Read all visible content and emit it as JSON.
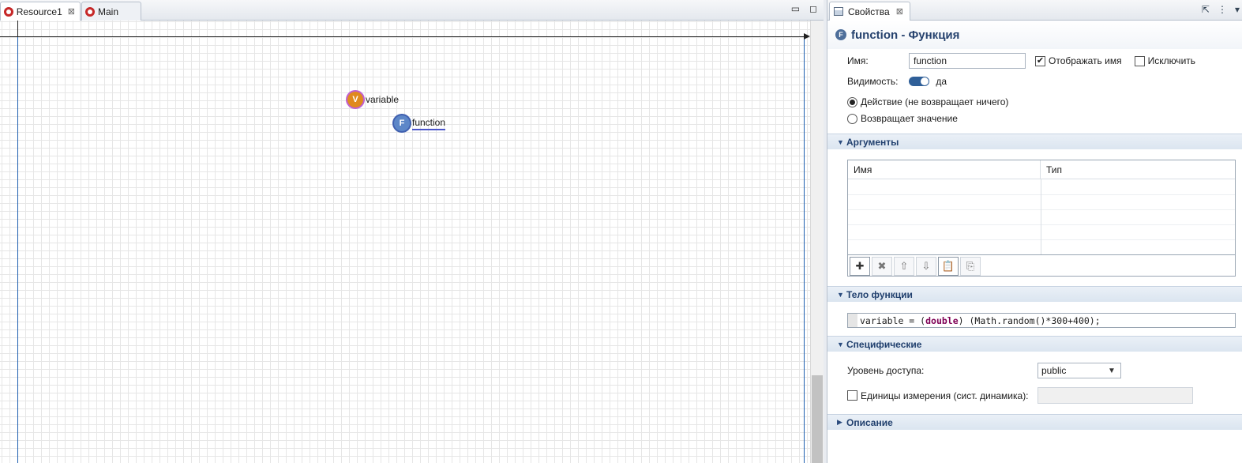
{
  "editor": {
    "tabs": [
      {
        "label": "Resource1",
        "close": "⊠",
        "icon": "resource-icon"
      },
      {
        "label": "Main",
        "icon": "resource-icon"
      }
    ],
    "window_controls": {
      "minimize": "▭",
      "maximize": "◻"
    },
    "canvas": {
      "variable_icon_letter": "V",
      "variable_label": "variable",
      "function_icon_letter": "F",
      "function_label": "function"
    }
  },
  "properties": {
    "tab_label": "Свойства",
    "tab_close": "⊠",
    "toolbar": {
      "pin": "⇱",
      "menu": "⋮",
      "more": "▾"
    },
    "title_icon_letter": "F",
    "title": "function - Функция",
    "name_label": "Имя:",
    "name_value": "function",
    "show_name_label": "Отображать имя",
    "show_name_checked": true,
    "exclude_label": "Исключить",
    "exclude_checked": false,
    "visibility_label": "Видимость:",
    "visibility_value": "да",
    "action_option": "Действие (не возвращает ничего)",
    "returns_option": "Возвращает значение",
    "selected_option": "action",
    "sections": {
      "arguments": "Аргументы",
      "body": "Тело функции",
      "specific": "Специфические",
      "description": "Описание"
    },
    "arguments_table": {
      "headers": [
        "Имя",
        "Тип"
      ],
      "rows": []
    },
    "arg_buttons": {
      "add": "✚",
      "delete": "✖",
      "up": "⇧",
      "down": "⇩",
      "paste": "📋",
      "copy": "⎘"
    },
    "code": {
      "pre": "variable = (",
      "kw": "double",
      "post": ") (Math.random()*300+400);"
    },
    "access_label": "Уровень доступа:",
    "access_value": "public",
    "units_label": "Единицы измерения (сист. динамика):",
    "units_checked": false
  }
}
